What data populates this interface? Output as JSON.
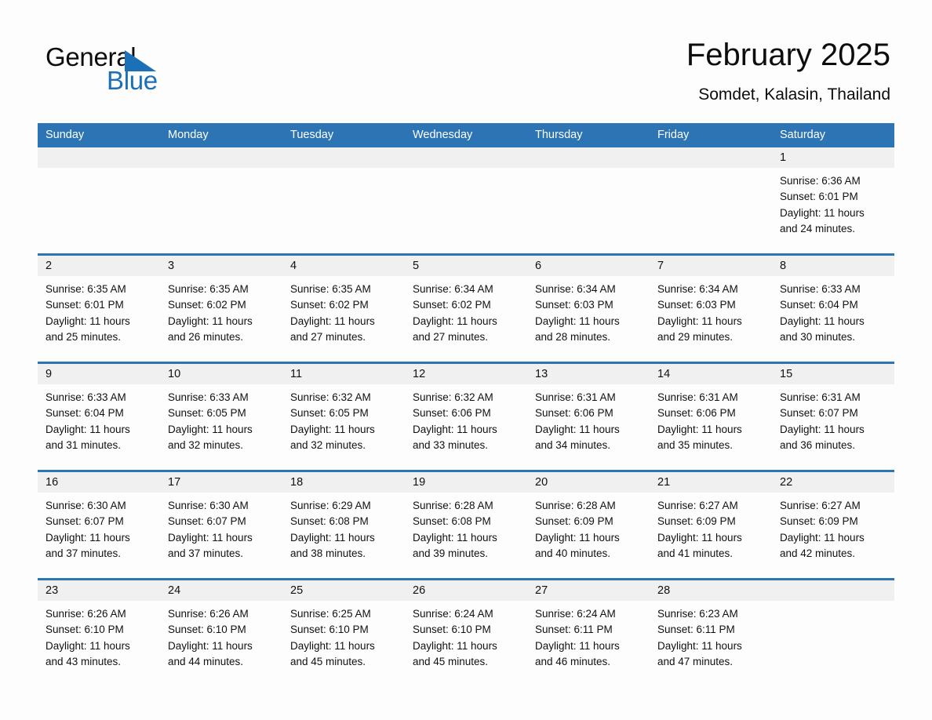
{
  "brand": {
    "name_part1": "General",
    "name_part2": "Blue",
    "triangle_icon": "triangle-icon",
    "color_black": "#0d0d0d",
    "color_blue": "#1b70b8"
  },
  "header": {
    "title": "February 2025",
    "subtitle": "Somdet, Kalasin, Thailand"
  },
  "theme": {
    "header_blue": "#2d74b5",
    "day_strip_gray": "#f0f0f0",
    "page_background": "#fdfdfd",
    "text": "#111111"
  },
  "calendar": {
    "weekdays": [
      "Sunday",
      "Monday",
      "Tuesday",
      "Wednesday",
      "Thursday",
      "Friday",
      "Saturday"
    ],
    "weeks": [
      [
        {
          "empty": true
        },
        {
          "empty": true
        },
        {
          "empty": true
        },
        {
          "empty": true
        },
        {
          "empty": true
        },
        {
          "empty": true
        },
        {
          "day": "1",
          "sunrise": "Sunrise: 6:36 AM",
          "sunset": "Sunset: 6:01 PM",
          "daylight1": "Daylight: 11 hours",
          "daylight2": "and 24 minutes."
        }
      ],
      [
        {
          "day": "2",
          "sunrise": "Sunrise: 6:35 AM",
          "sunset": "Sunset: 6:01 PM",
          "daylight1": "Daylight: 11 hours",
          "daylight2": "and 25 minutes."
        },
        {
          "day": "3",
          "sunrise": "Sunrise: 6:35 AM",
          "sunset": "Sunset: 6:02 PM",
          "daylight1": "Daylight: 11 hours",
          "daylight2": "and 26 minutes."
        },
        {
          "day": "4",
          "sunrise": "Sunrise: 6:35 AM",
          "sunset": "Sunset: 6:02 PM",
          "daylight1": "Daylight: 11 hours",
          "daylight2": "and 27 minutes."
        },
        {
          "day": "5",
          "sunrise": "Sunrise: 6:34 AM",
          "sunset": "Sunset: 6:02 PM",
          "daylight1": "Daylight: 11 hours",
          "daylight2": "and 27 minutes."
        },
        {
          "day": "6",
          "sunrise": "Sunrise: 6:34 AM",
          "sunset": "Sunset: 6:03 PM",
          "daylight1": "Daylight: 11 hours",
          "daylight2": "and 28 minutes."
        },
        {
          "day": "7",
          "sunrise": "Sunrise: 6:34 AM",
          "sunset": "Sunset: 6:03 PM",
          "daylight1": "Daylight: 11 hours",
          "daylight2": "and 29 minutes."
        },
        {
          "day": "8",
          "sunrise": "Sunrise: 6:33 AM",
          "sunset": "Sunset: 6:04 PM",
          "daylight1": "Daylight: 11 hours",
          "daylight2": "and 30 minutes."
        }
      ],
      [
        {
          "day": "9",
          "sunrise": "Sunrise: 6:33 AM",
          "sunset": "Sunset: 6:04 PM",
          "daylight1": "Daylight: 11 hours",
          "daylight2": "and 31 minutes."
        },
        {
          "day": "10",
          "sunrise": "Sunrise: 6:33 AM",
          "sunset": "Sunset: 6:05 PM",
          "daylight1": "Daylight: 11 hours",
          "daylight2": "and 32 minutes."
        },
        {
          "day": "11",
          "sunrise": "Sunrise: 6:32 AM",
          "sunset": "Sunset: 6:05 PM",
          "daylight1": "Daylight: 11 hours",
          "daylight2": "and 32 minutes."
        },
        {
          "day": "12",
          "sunrise": "Sunrise: 6:32 AM",
          "sunset": "Sunset: 6:06 PM",
          "daylight1": "Daylight: 11 hours",
          "daylight2": "and 33 minutes."
        },
        {
          "day": "13",
          "sunrise": "Sunrise: 6:31 AM",
          "sunset": "Sunset: 6:06 PM",
          "daylight1": "Daylight: 11 hours",
          "daylight2": "and 34 minutes."
        },
        {
          "day": "14",
          "sunrise": "Sunrise: 6:31 AM",
          "sunset": "Sunset: 6:06 PM",
          "daylight1": "Daylight: 11 hours",
          "daylight2": "and 35 minutes."
        },
        {
          "day": "15",
          "sunrise": "Sunrise: 6:31 AM",
          "sunset": "Sunset: 6:07 PM",
          "daylight1": "Daylight: 11 hours",
          "daylight2": "and 36 minutes."
        }
      ],
      [
        {
          "day": "16",
          "sunrise": "Sunrise: 6:30 AM",
          "sunset": "Sunset: 6:07 PM",
          "daylight1": "Daylight: 11 hours",
          "daylight2": "and 37 minutes."
        },
        {
          "day": "17",
          "sunrise": "Sunrise: 6:30 AM",
          "sunset": "Sunset: 6:07 PM",
          "daylight1": "Daylight: 11 hours",
          "daylight2": "and 37 minutes."
        },
        {
          "day": "18",
          "sunrise": "Sunrise: 6:29 AM",
          "sunset": "Sunset: 6:08 PM",
          "daylight1": "Daylight: 11 hours",
          "daylight2": "and 38 minutes."
        },
        {
          "day": "19",
          "sunrise": "Sunrise: 6:28 AM",
          "sunset": "Sunset: 6:08 PM",
          "daylight1": "Daylight: 11 hours",
          "daylight2": "and 39 minutes."
        },
        {
          "day": "20",
          "sunrise": "Sunrise: 6:28 AM",
          "sunset": "Sunset: 6:09 PM",
          "daylight1": "Daylight: 11 hours",
          "daylight2": "and 40 minutes."
        },
        {
          "day": "21",
          "sunrise": "Sunrise: 6:27 AM",
          "sunset": "Sunset: 6:09 PM",
          "daylight1": "Daylight: 11 hours",
          "daylight2": "and 41 minutes."
        },
        {
          "day": "22",
          "sunrise": "Sunrise: 6:27 AM",
          "sunset": "Sunset: 6:09 PM",
          "daylight1": "Daylight: 11 hours",
          "daylight2": "and 42 minutes."
        }
      ],
      [
        {
          "day": "23",
          "sunrise": "Sunrise: 6:26 AM",
          "sunset": "Sunset: 6:10 PM",
          "daylight1": "Daylight: 11 hours",
          "daylight2": "and 43 minutes."
        },
        {
          "day": "24",
          "sunrise": "Sunrise: 6:26 AM",
          "sunset": "Sunset: 6:10 PM",
          "daylight1": "Daylight: 11 hours",
          "daylight2": "and 44 minutes."
        },
        {
          "day": "25",
          "sunrise": "Sunrise: 6:25 AM",
          "sunset": "Sunset: 6:10 PM",
          "daylight1": "Daylight: 11 hours",
          "daylight2": "and 45 minutes."
        },
        {
          "day": "26",
          "sunrise": "Sunrise: 6:24 AM",
          "sunset": "Sunset: 6:10 PM",
          "daylight1": "Daylight: 11 hours",
          "daylight2": "and 45 minutes."
        },
        {
          "day": "27",
          "sunrise": "Sunrise: 6:24 AM",
          "sunset": "Sunset: 6:11 PM",
          "daylight1": "Daylight: 11 hours",
          "daylight2": "and 46 minutes."
        },
        {
          "day": "28",
          "sunrise": "Sunrise: 6:23 AM",
          "sunset": "Sunset: 6:11 PM",
          "daylight1": "Daylight: 11 hours",
          "daylight2": "and 47 minutes."
        },
        {
          "empty": true
        }
      ]
    ]
  }
}
